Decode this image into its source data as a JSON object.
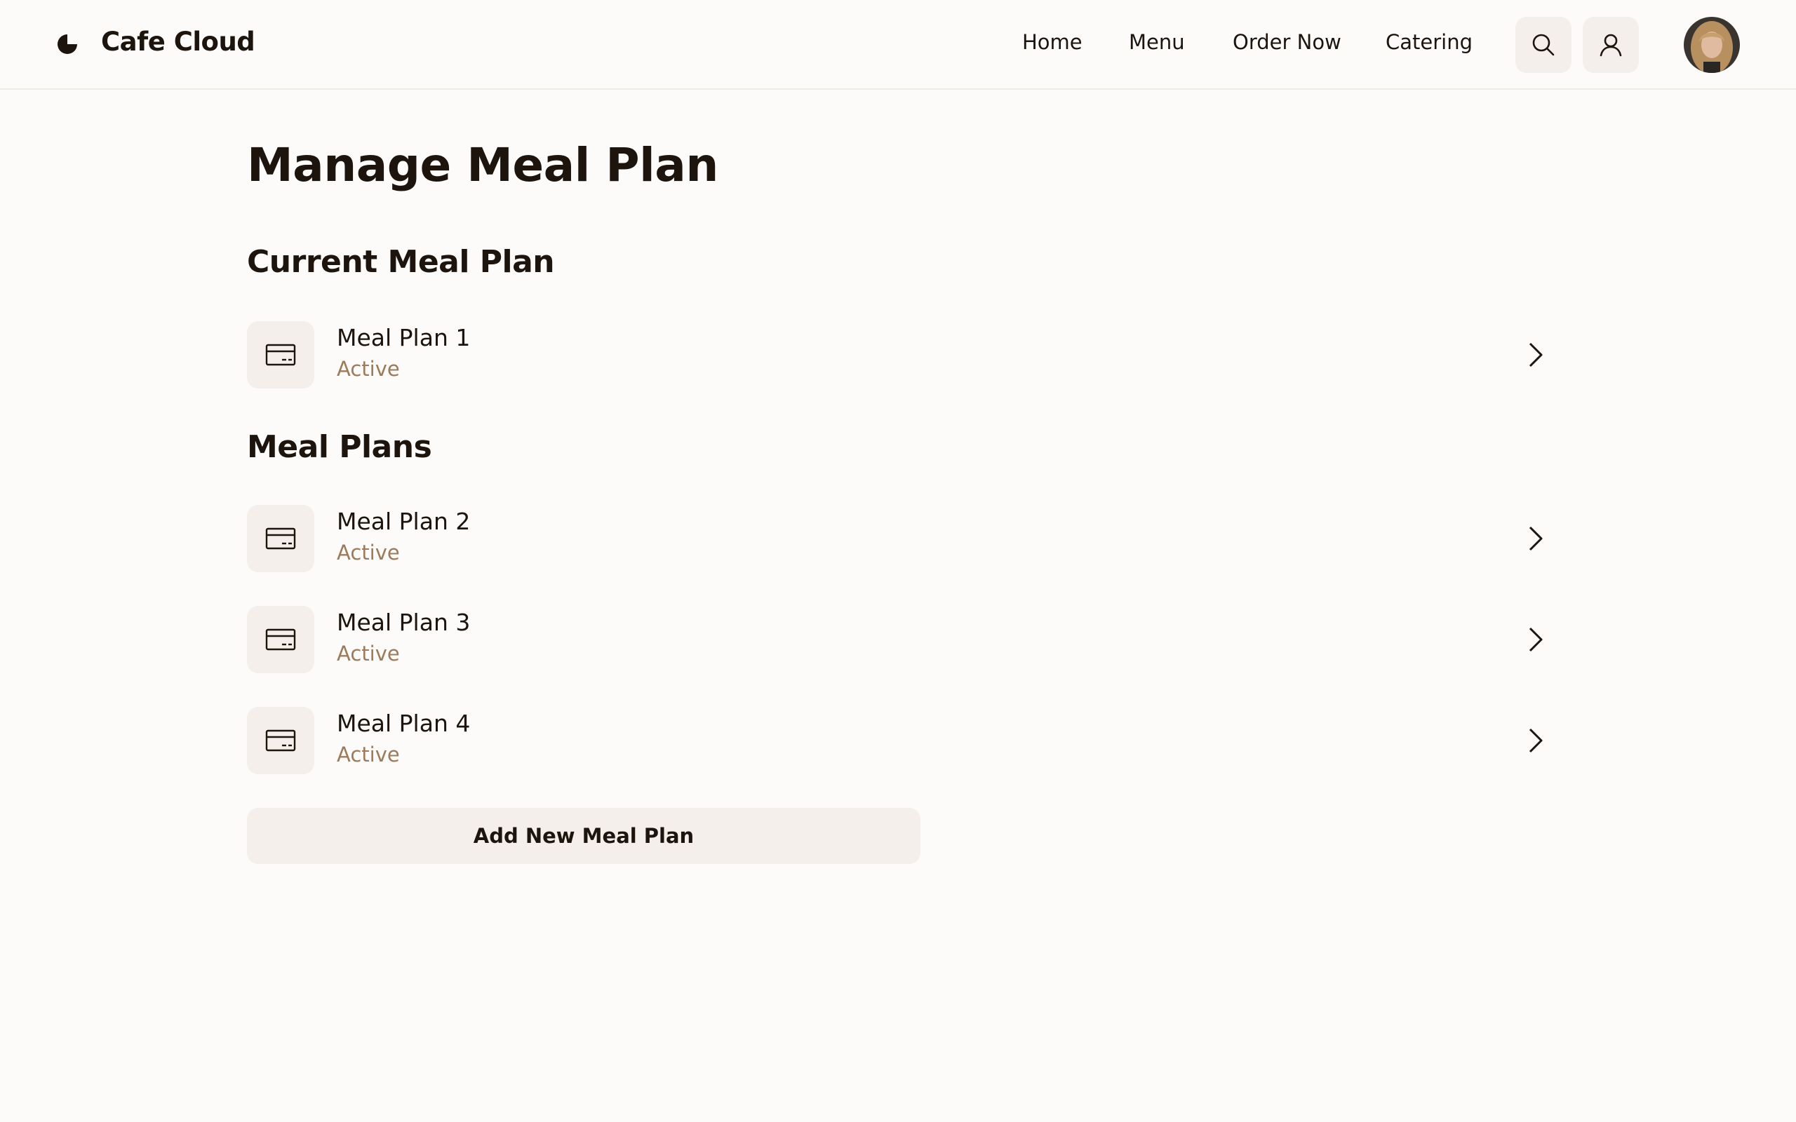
{
  "header": {
    "brand": "Cafe Cloud",
    "nav": [
      "Home",
      "Menu",
      "Order Now",
      "Catering"
    ],
    "icons": [
      "search-icon",
      "user-icon"
    ]
  },
  "page": {
    "title": "Manage Meal Plan"
  },
  "current_section": {
    "title": "Current Meal Plan",
    "items": [
      {
        "name": "Meal Plan 1",
        "status": "Active",
        "icon": "credit-card-icon"
      }
    ]
  },
  "plans_section": {
    "title": "Meal Plans",
    "items": [
      {
        "name": "Meal Plan 2",
        "status": "Active",
        "icon": "credit-card-icon"
      },
      {
        "name": "Meal Plan 3",
        "status": "Active",
        "icon": "credit-card-icon"
      },
      {
        "name": "Meal Plan 4",
        "status": "Active",
        "icon": "credit-card-icon"
      }
    ]
  },
  "actions": {
    "add_label": "Add New Meal Plan"
  },
  "colors": {
    "background": "#fcfbf9",
    "text": "#1c140d",
    "muted": "#9c7a5a",
    "surface": "#f4efea"
  }
}
